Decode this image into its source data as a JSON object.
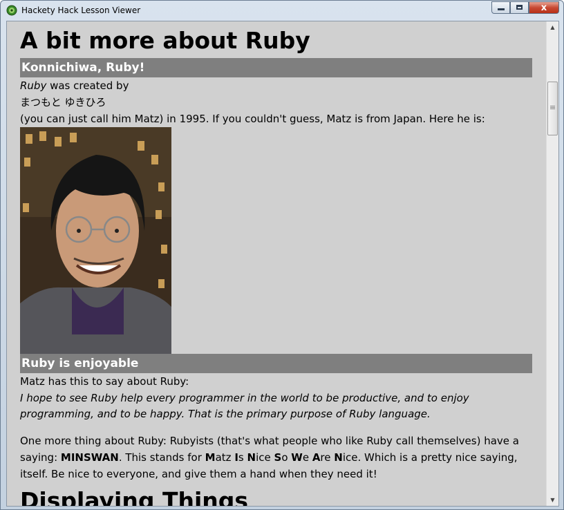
{
  "window": {
    "title": "Hackety Hack Lesson Viewer",
    "minimize_label": "",
    "maximize_label": "",
    "close_label": "x"
  },
  "lesson": {
    "heading": "A bit more about Ruby",
    "section1": {
      "title": "Konnichiwa, Ruby!",
      "line1_emph": "Ruby",
      "line1_rest": " was created by",
      "japanese_name": "まつもと ゆきひろ",
      "line3": "(you can just call him Matz) in 1995. If you couldn't guess, Matz is from Japan. Here he is:"
    },
    "section2": {
      "title": "Ruby is enjoyable",
      "intro": "Matz has this to say about Ruby:",
      "quote": "I hope to see Ruby help every programmer in the world to be productive, and to enjoy programming, and to be happy. That is the primary purpose of Ruby language.",
      "p_start": "One more thing about Ruby: Rubyists (that's what people who like Ruby call themselves) have a saying: ",
      "acronym": "MINSWAN",
      "p_mid": ". This stands for ",
      "words": [
        {
          "b": "M",
          "r": "atz "
        },
        {
          "b": "I",
          "r": "s "
        },
        {
          "b": "N",
          "r": "ice "
        },
        {
          "b": "S",
          "r": "o "
        },
        {
          "b": "W",
          "r": "e "
        },
        {
          "b": "A",
          "r": "re "
        },
        {
          "b": "N",
          "r": "ice"
        }
      ],
      "p_end": ". Which is a pretty nice saying, itself. Be nice to everyone, and give them a hand when they need it!"
    },
    "next_heading": "Displaying Things"
  },
  "colors": {
    "background": "#d0d0d0",
    "section_bar": "#7f7f7f",
    "section_text": "#ffffff"
  },
  "icons": {
    "app": "hackety-hack-icon",
    "scroll_up": "arrow-up",
    "scroll_down": "arrow-down"
  }
}
